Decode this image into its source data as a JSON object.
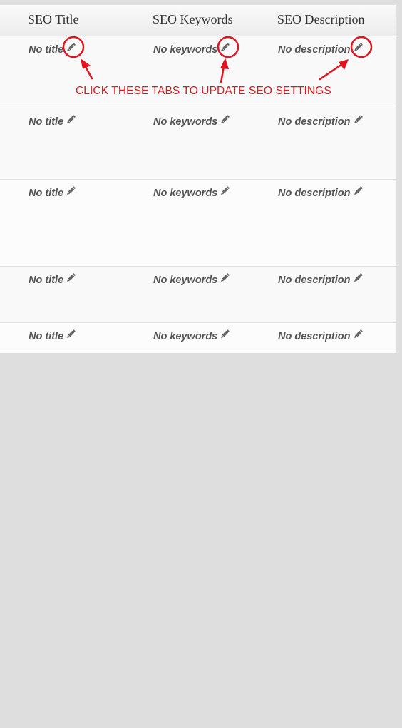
{
  "table": {
    "headers": [
      "SEO Title",
      "SEO Keywords",
      "SEO Description"
    ],
    "rows": [
      {
        "title": "No title",
        "keywords": "No keywords",
        "description": "No description"
      },
      {
        "title": "No title",
        "keywords": "No keywords",
        "description": "No description"
      },
      {
        "title": "No title",
        "keywords": "No keywords",
        "description": "No description"
      },
      {
        "title": "No title",
        "keywords": "No keywords",
        "description": "No description"
      },
      {
        "title": "No title",
        "keywords": "No keywords",
        "description": "No description"
      }
    ]
  },
  "annotation": {
    "text": "CLICK THESE TABS TO UPDATE SEO SETTINGS",
    "color": "#e3141e"
  },
  "icons": {
    "edit": "pencil-icon"
  },
  "colors": {
    "background": "#dedede",
    "text": "#555555",
    "header_text": "#333333"
  }
}
